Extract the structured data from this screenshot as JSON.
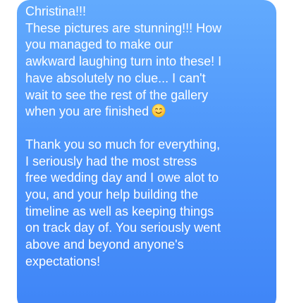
{
  "message": {
    "paragraph_1_lines": [
      "Christina!!!",
      "These pictures are stunning!!! How",
      "you managed to make our",
      "awkward laughing turn into these! I",
      "have absolutely no clue... I can't",
      "wait to see the rest of the gallery",
      "when you are finished"
    ],
    "emoji_icon": "smiling-face-icon",
    "paragraph_2_lines": [
      "Thank you so much for everything,",
      "I seriously had the most stress",
      "free wedding day and I owe alot to",
      "you, and your help building the",
      "timeline as well as keeping things",
      "on track day of. You seriously went",
      "above and beyond anyone's",
      "expectations!"
    ],
    "bubble_color": "#4f97fb",
    "text_color": "#ffffff"
  }
}
